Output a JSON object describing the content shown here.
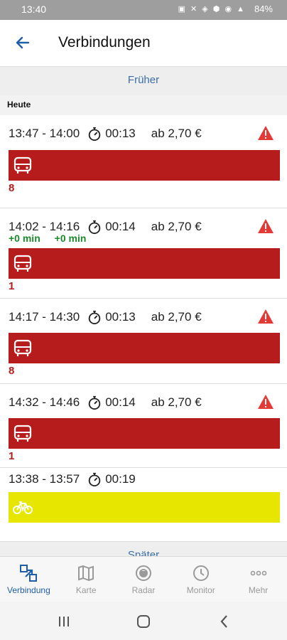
{
  "status": {
    "time": "13:40",
    "battery": "84%"
  },
  "header": {
    "title": "Verbindungen"
  },
  "earlier_label": "Früher",
  "day_label": "Heute",
  "later_label": "Später",
  "connections": [
    {
      "times": "13:47 - 14:00",
      "duration": "00:13",
      "price": "ab 2,70 €",
      "line": "8",
      "mode": "bus",
      "warning": true
    },
    {
      "times": "14:02 - 14:16",
      "duration": "00:14",
      "price": "ab 2,70 €",
      "line": "1",
      "mode": "bus",
      "warning": true,
      "delays": [
        "+0 min",
        "+0 min"
      ]
    },
    {
      "times": "14:17 - 14:30",
      "duration": "00:13",
      "price": "ab 2,70 €",
      "line": "8",
      "mode": "bus",
      "warning": true
    },
    {
      "times": "14:32 - 14:46",
      "duration": "00:14",
      "price": "ab 2,70 €",
      "line": "1",
      "mode": "bus",
      "warning": true
    },
    {
      "times": "13:38 - 13:57",
      "duration": "00:19",
      "mode": "bike",
      "warning": false
    }
  ],
  "nav": [
    {
      "label": "Verbindung",
      "icon": "connection-icon",
      "active": true
    },
    {
      "label": "Karte",
      "icon": "map-icon",
      "active": false
    },
    {
      "label": "Radar",
      "icon": "radar-icon",
      "active": false
    },
    {
      "label": "Monitor",
      "icon": "clock-icon",
      "active": false
    },
    {
      "label": "Mehr",
      "icon": "more-icon",
      "active": false
    }
  ],
  "colors": {
    "accent": "#1f5fa8",
    "bus": "#b71c1c",
    "bike": "#e6e600",
    "warning": "#e53935",
    "delay": "#1a8a2a"
  }
}
